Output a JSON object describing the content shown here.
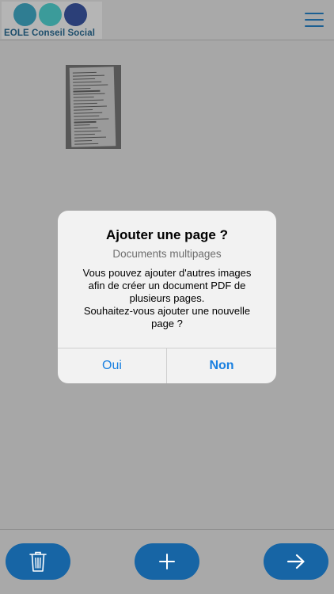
{
  "header": {
    "logo_text": "EOLE Conseil Social",
    "logo_colors": [
      "#2f7d92",
      "#3b9b9a",
      "#2b3f78"
    ]
  },
  "thumbnail": {
    "receipt_lines": 24,
    "receipt_amount": "42.00 EUR"
  },
  "dialog": {
    "title": "Ajouter une page ?",
    "subtitle": "Documents multipages",
    "message_lines": [
      "Vous pouvez ajouter d'autres images",
      "afin de créer un document PDF de",
      "plusieurs pages.",
      "Souhaitez-vous ajouter une nouvelle",
      "page ?"
    ],
    "button_yes": "Oui",
    "button_no": "Non",
    "accent_color": "#1a80e0"
  },
  "toolbar": {
    "delete_icon": "trash-icon",
    "add_icon": "plus-icon",
    "next_icon": "arrow-right-icon",
    "button_color": "#1765a5"
  }
}
